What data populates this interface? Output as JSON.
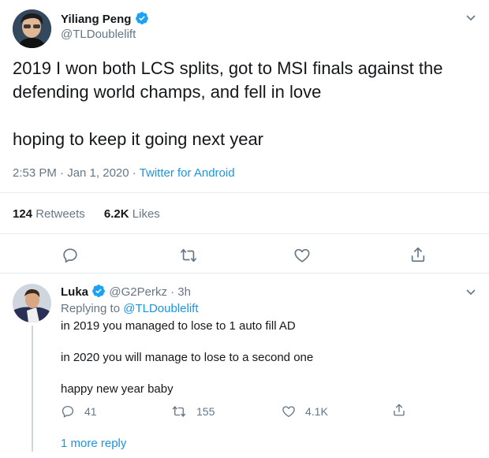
{
  "tweet": {
    "author_name": "Yiliang Peng",
    "author_handle": "@TLDoublelift",
    "text_line1": "2019 I won both LCS splits, got to MSI finals against the",
    "text_line2": "defending world champs, and fell in love",
    "text_line3": "hoping to keep it going next year",
    "timestamp": "2:53 PM · Jan 1, 2020",
    "separator": " · ",
    "source": "Twitter for Android",
    "retweets_count": "124",
    "retweets_label": "Retweets",
    "likes_count": "6.2K",
    "likes_label": "Likes"
  },
  "reply": {
    "author_name": "Luka",
    "author_handle": "@G2Perkz",
    "time": " · 3h",
    "replying_prefix": "Replying to ",
    "replying_to": "@TLDoublelift",
    "line1": "in 2019 you managed to lose to 1 auto fill AD",
    "line2": "in 2020 you will manage to lose to a second one",
    "line3": "happy new year baby",
    "reply_count": "41",
    "retweet_count": "155",
    "like_count": "4.1K",
    "more_replies": "1 more reply"
  },
  "colors": {
    "accent": "#1b95e0",
    "muted": "#657786",
    "divider": "#e6ecf0",
    "verified": "#1da1f2"
  },
  "icons": [
    "verified-icon",
    "chevron-down-icon",
    "reply-icon",
    "retweet-icon",
    "like-icon",
    "share-icon"
  ]
}
